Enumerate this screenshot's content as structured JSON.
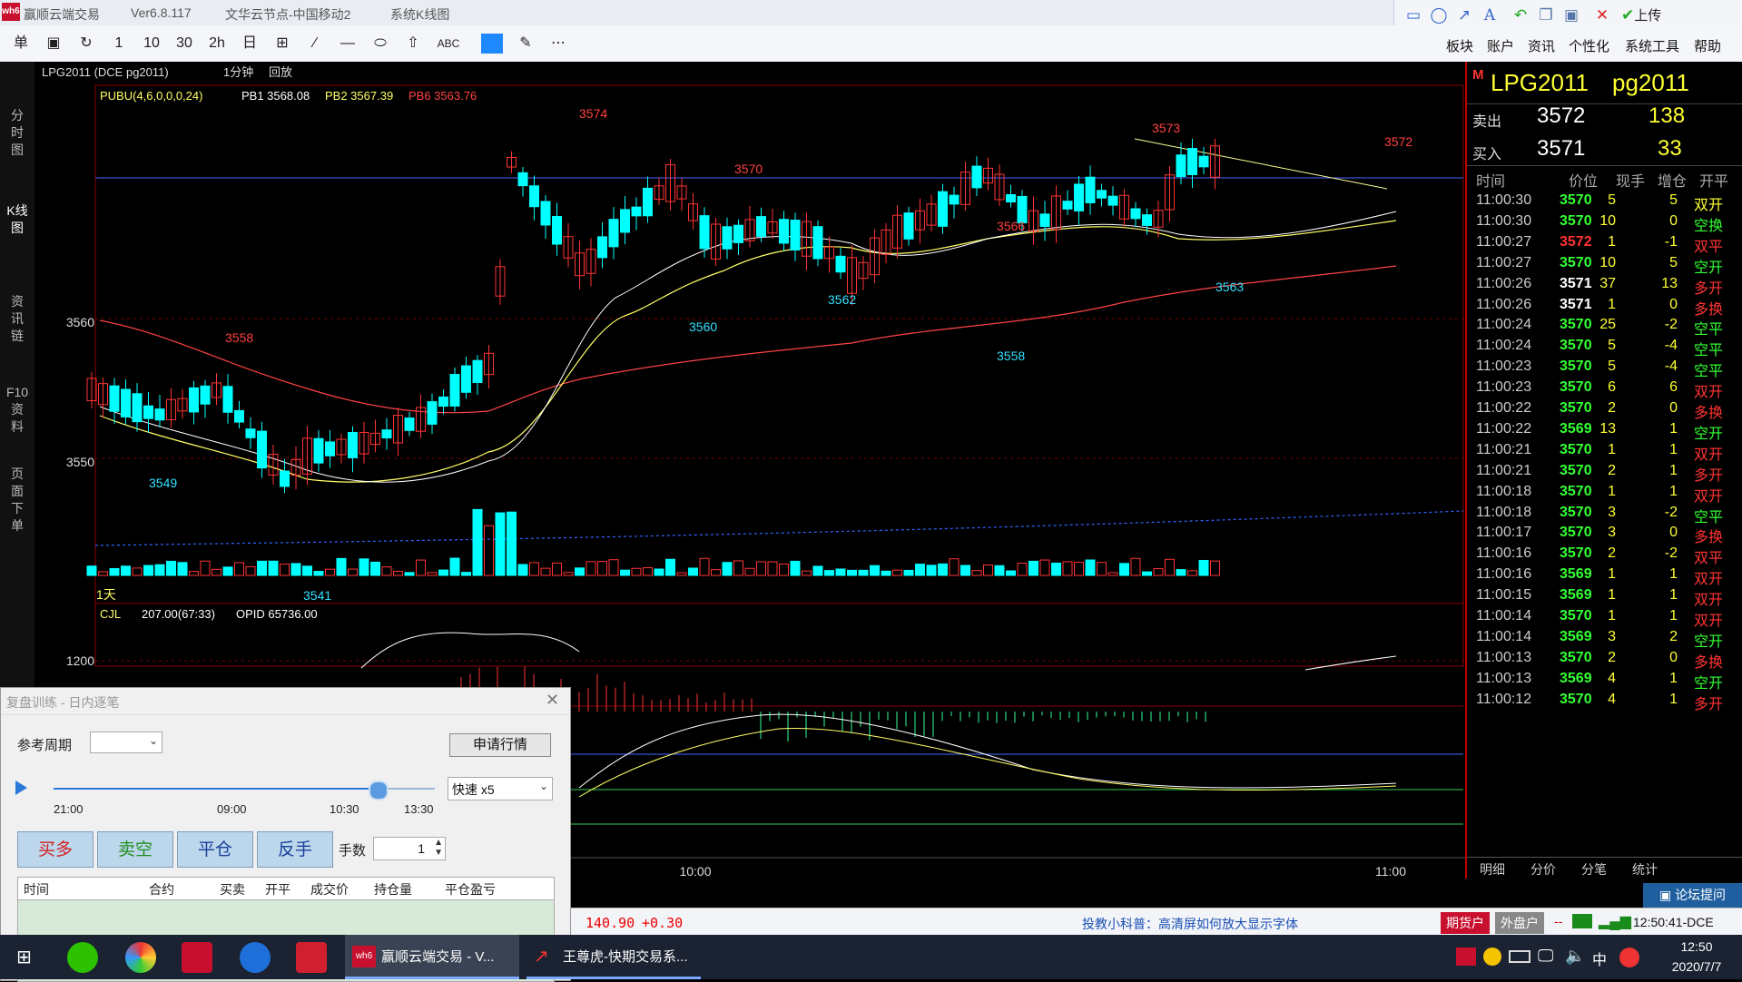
{
  "window": {
    "app_name": "赢顺云端交易",
    "version": "Ver6.8.117",
    "server": "文华云节点-中国移动2",
    "module": "系统K线图",
    "logo": "wh6"
  },
  "top_tools": {
    "upload_label": "上传",
    "icons": [
      "rect-icon",
      "ellipse-icon",
      "arrow-icon",
      "text-icon",
      "undo-icon",
      "copy-icon",
      "save-icon",
      "close-icon",
      "check-icon"
    ]
  },
  "toolbar": {
    "buttons": [
      "单",
      "",
      "",
      "1",
      "10",
      "30",
      "2h",
      "日",
      "",
      "",
      "",
      "",
      "",
      "ABC",
      "",
      "",
      ""
    ],
    "menus": [
      "板块",
      "账户",
      "资讯",
      "个性化",
      "系统工具",
      "帮助"
    ]
  },
  "left_tabs": [
    "分时图",
    "K线图",
    "资讯链",
    "F10资料",
    "页面下单"
  ],
  "chart": {
    "header_instrument": "LPG2011 (DCE pg2011)",
    "header_period": "1分钟",
    "header_mode": "回放",
    "indicator_name": "PUBU(4,6,0,0,0,24)",
    "pb1_label": "PB1 3568.08",
    "pb2_label": "PB2 3567.39",
    "pb6_label": "PB6 3563.76",
    "day_label": "1天",
    "y_ticks": [
      "3560",
      "3550"
    ],
    "volume_label": "CJL",
    "volume_value": "207.00(67:33)",
    "opid_value": "OPID 65736.00",
    "volume_tick": "1200",
    "time_ticks": [
      "10:00",
      "11:00"
    ],
    "annotations": [
      {
        "text": "3574",
        "color": "#ff4040"
      },
      {
        "text": "3570",
        "color": "#ff4040"
      },
      {
        "text": "3573",
        "color": "#ff4040"
      },
      {
        "text": "3572",
        "color": "#ff4040"
      },
      {
        "text": "3566",
        "color": "#ff4040"
      },
      {
        "text": "3558",
        "color": "#ff4040"
      },
      {
        "text": "3562",
        "color": "#33e0ff"
      },
      {
        "text": "3560",
        "color": "#33e0ff"
      },
      {
        "text": "3563",
        "color": "#33e0ff"
      },
      {
        "text": "3558",
        "color": "#33e0ff"
      },
      {
        "text": "3549",
        "color": "#33e0ff"
      },
      {
        "text": "3541",
        "color": "#33e0ff"
      }
    ],
    "colors": {
      "up": "#ff3333",
      "down": "#00ffff",
      "ma_fast": "#ffffff",
      "ma_mid": "#ffff66",
      "ma_slow": "#ff4444"
    }
  },
  "right_panel": {
    "flag": "M",
    "name": "LPG2011",
    "code": "pg2011",
    "sell_label": "卖出",
    "sell_price": "3572",
    "sell_vol": "138",
    "buy_label": "买入",
    "buy_price": "3571",
    "buy_vol": "33",
    "col_time": "时间",
    "col_price": "价位",
    "col_qty": "现手",
    "col_oi": "增仓",
    "col_type": "开平",
    "ticks": [
      {
        "time": "11:00:30",
        "price": "3570",
        "qty": "5",
        "oi": "5",
        "type": "双开",
        "pc": "#33ff33",
        "tc": "#ffff33"
      },
      {
        "time": "11:00:30",
        "price": "3570",
        "qty": "10",
        "oi": "0",
        "type": "空换",
        "pc": "#33ff33",
        "tc": "#33ff33"
      },
      {
        "time": "11:00:27",
        "price": "3572",
        "qty": "1",
        "oi": "-1",
        "type": "双平",
        "pc": "#ff3333",
        "tc": "#ff3333"
      },
      {
        "time": "11:00:27",
        "price": "3570",
        "qty": "10",
        "oi": "5",
        "type": "空开",
        "pc": "#33ff33",
        "tc": "#33ff33"
      },
      {
        "time": "11:00:26",
        "price": "3571",
        "qty": "37",
        "oi": "13",
        "type": "多开",
        "pc": "#ffffff",
        "tc": "#ff3333"
      },
      {
        "time": "11:00:26",
        "price": "3571",
        "qty": "1",
        "oi": "0",
        "type": "多换",
        "pc": "#ffffff",
        "tc": "#ff3333"
      },
      {
        "time": "11:00:24",
        "price": "3570",
        "qty": "25",
        "oi": "-2",
        "type": "空平",
        "pc": "#33ff33",
        "tc": "#33ff33"
      },
      {
        "time": "11:00:24",
        "price": "3570",
        "qty": "5",
        "oi": "-4",
        "type": "空平",
        "pc": "#33ff33",
        "tc": "#33ff33"
      },
      {
        "time": "11:00:23",
        "price": "3570",
        "qty": "5",
        "oi": "-4",
        "type": "空平",
        "pc": "#33ff33",
        "tc": "#33ff33"
      },
      {
        "time": "11:00:23",
        "price": "3570",
        "qty": "6",
        "oi": "6",
        "type": "双开",
        "pc": "#33ff33",
        "tc": "#ff3333"
      },
      {
        "time": "11:00:22",
        "price": "3570",
        "qty": "2",
        "oi": "0",
        "type": "多换",
        "pc": "#33ff33",
        "tc": "#ff3333"
      },
      {
        "time": "11:00:22",
        "price": "3569",
        "qty": "13",
        "oi": "1",
        "type": "空开",
        "pc": "#33ff33",
        "tc": "#33ff33"
      },
      {
        "time": "11:00:21",
        "price": "3570",
        "qty": "1",
        "oi": "1",
        "type": "双开",
        "pc": "#33ff33",
        "tc": "#ff3333"
      },
      {
        "time": "11:00:21",
        "price": "3570",
        "qty": "2",
        "oi": "1",
        "type": "多开",
        "pc": "#33ff33",
        "tc": "#ff3333"
      },
      {
        "time": "11:00:18",
        "price": "3570",
        "qty": "1",
        "oi": "1",
        "type": "双开",
        "pc": "#33ff33",
        "tc": "#ff3333"
      },
      {
        "time": "11:00:18",
        "price": "3570",
        "qty": "3",
        "oi": "-2",
        "type": "空平",
        "pc": "#33ff33",
        "tc": "#33ff33"
      },
      {
        "time": "11:00:17",
        "price": "3570",
        "qty": "3",
        "oi": "0",
        "type": "多换",
        "pc": "#33ff33",
        "tc": "#ff3333"
      },
      {
        "time": "11:00:16",
        "price": "3570",
        "qty": "2",
        "oi": "-2",
        "type": "双平",
        "pc": "#33ff33",
        "tc": "#ff3333"
      },
      {
        "time": "11:00:16",
        "price": "3569",
        "qty": "1",
        "oi": "1",
        "type": "双开",
        "pc": "#33ff33",
        "tc": "#ff3333"
      },
      {
        "time": "11:00:15",
        "price": "3569",
        "qty": "1",
        "oi": "1",
        "type": "双开",
        "pc": "#33ff33",
        "tc": "#ff3333"
      },
      {
        "time": "11:00:14",
        "price": "3570",
        "qty": "1",
        "oi": "1",
        "type": "双开",
        "pc": "#33ff33",
        "tc": "#ff3333"
      },
      {
        "time": "11:00:14",
        "price": "3569",
        "qty": "3",
        "oi": "2",
        "type": "空开",
        "pc": "#33ff33",
        "tc": "#33ff33"
      },
      {
        "time": "11:00:13",
        "price": "3570",
        "qty": "2",
        "oi": "0",
        "type": "多换",
        "pc": "#33ff33",
        "tc": "#ff3333"
      },
      {
        "time": "11:00:13",
        "price": "3569",
        "qty": "4",
        "oi": "1",
        "type": "空开",
        "pc": "#33ff33",
        "tc": "#33ff33"
      },
      {
        "time": "11:00:12",
        "price": "3570",
        "qty": "4",
        "oi": "1",
        "type": "多开",
        "pc": "#33ff33",
        "tc": "#ff3333"
      }
    ],
    "bottom_tabs": [
      "明细",
      "分价",
      "分笔",
      "统计"
    ],
    "forum_button": "论坛提问"
  },
  "dialog": {
    "title": "复盘训练 - 日内逐笔",
    "ref_period_label": "参考周期",
    "request_button": "申请行情",
    "slider_ticks": [
      "21:00",
      "09:00",
      "10:30",
      "13:30"
    ],
    "slider_progress": 0.85,
    "speed_value": "快速  x5",
    "buy_long": "买多",
    "sell_short": "卖空",
    "close_position": "平仓",
    "reverse": "反手",
    "lots_label": "手数",
    "lots_value": "1",
    "columns": [
      "时间",
      "合约",
      "买卖",
      "开平",
      "成交价",
      "持仓量",
      "平仓盈亏"
    ]
  },
  "status": {
    "price": "140.90",
    "change": "+0.30",
    "tip": "投教小科普：高清屏如何放大显示字体",
    "futures_account": "期货户",
    "foreign_account": "外盘户",
    "dashes": "--",
    "clock": "12:50:41-DCE"
  },
  "taskbar": {
    "items": [
      {
        "label": "赢顺云端交易 - V..."
      },
      {
        "label": "王尊虎-快期交易系..."
      }
    ],
    "ime": "中",
    "time": "12:50",
    "date": "2020/7/7"
  }
}
